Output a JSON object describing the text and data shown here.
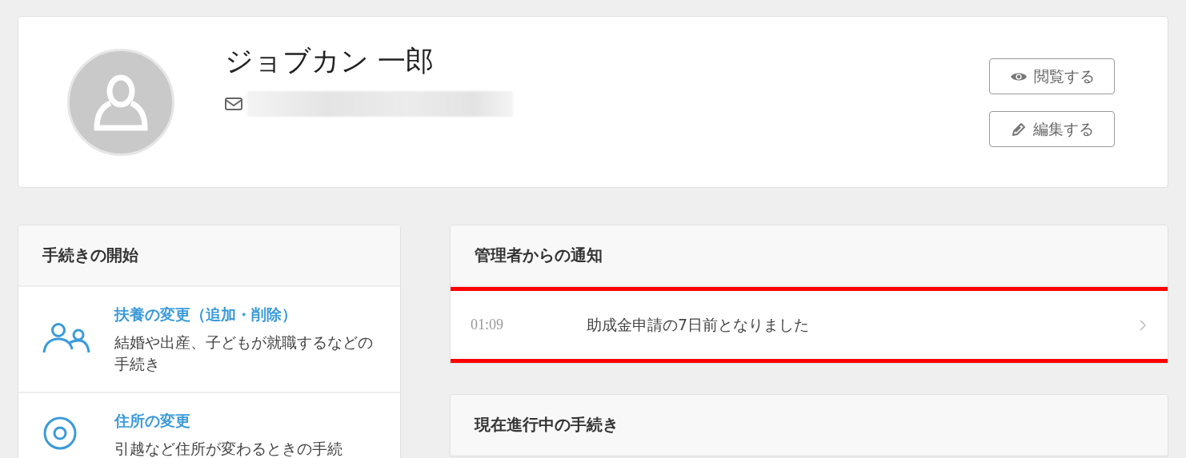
{
  "profile": {
    "name": "ジョブカン 一郎",
    "email_redacted": true,
    "buttons": [
      {
        "label": "閲覧する",
        "kind": "view"
      },
      {
        "label": "編集する",
        "kind": "edit"
      }
    ]
  },
  "start_panel": {
    "title": "手続きの開始",
    "items": [
      {
        "kind": "family",
        "title": "扶養の変更（追加・削除）",
        "description": "結婚や出産、子どもが就職するなどの手続き"
      },
      {
        "kind": "location",
        "title": "住所の変更",
        "description": "引越など住所が変わるときの手続"
      }
    ]
  },
  "notice_panel": {
    "title": "管理者からの通知",
    "notices": [
      {
        "time": "01:09",
        "message": "助成金申請の7日前となりました",
        "highlighted": true
      }
    ]
  },
  "progress_panel": {
    "title": "現在進行中の手続き"
  }
}
